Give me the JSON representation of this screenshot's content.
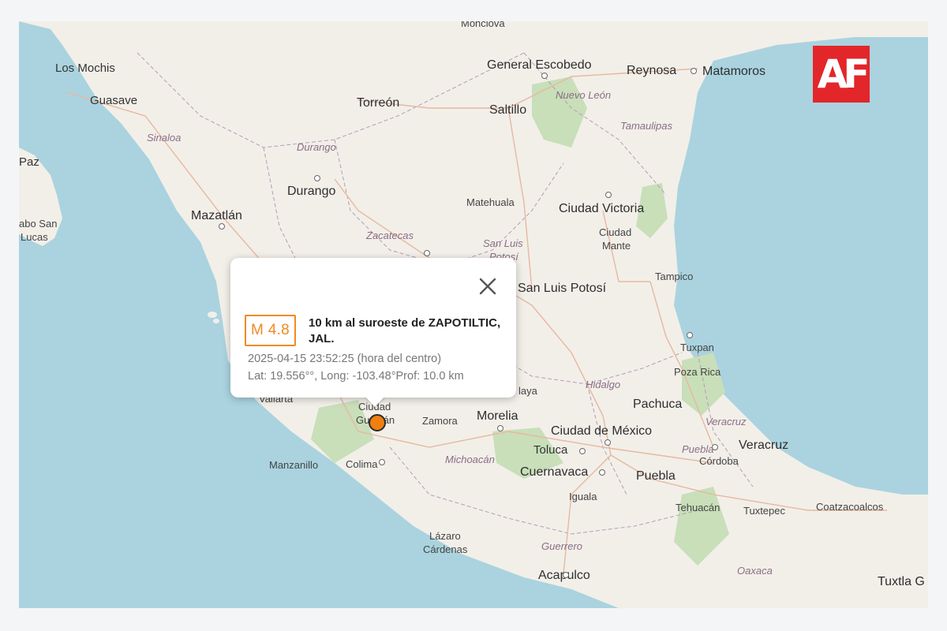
{
  "map": {
    "water_color": "#aad3df",
    "land_color": "#f2efe9",
    "labels": {
      "monclova": "Monclova",
      "los_mochis": "Los Mochis",
      "guasave": "Guasave",
      "torreon": "Torreón",
      "general_escobedo": "General Escobedo",
      "reynosa": "Reynosa",
      "matamoros": "Matamoros",
      "saltillo": "Saltillo",
      "nuevo_leon": "Nuevo León",
      "tamaulipas": "Tamaulipas",
      "sinaloa": "Sinaloa",
      "durango_state": "Durango",
      "paz": "Paz",
      "durango_city": "Durango",
      "matehuala": "Matehuala",
      "ciudad_victoria": "Ciudad Victoria",
      "cabo_san_lucas_1": "abo San",
      "cabo_san_lucas_2": "Lucas",
      "mazatlan": "Mazatlán",
      "ciudad_mante_1": "Ciudad",
      "ciudad_mante_2": "Mante",
      "zacatecas": "Zacatecas",
      "san_luis_state_1": "San Luis",
      "san_luis_state_2": "Potosí",
      "tampico": "Tampico",
      "san_luis_potosi": "San Luis Potosí",
      "tuxpan": "Tuxpan",
      "poza_rica": "Poza Rica",
      "hidalgo": "Hidalgo",
      "celaya_partial": "laya",
      "vallarta": "Vallarta",
      "pachuca": "Pachuca",
      "veracruz_state": "Veracruz",
      "morelia": "Morelia",
      "ciudad_guzman_1": "Ciudad",
      "ciudad_guzman_2": "Guzmán",
      "zamora": "Zamora",
      "ciudad_de_mexico": "Ciudad de México",
      "veracruz_city": "Veracruz",
      "puebla_state": "Puebla",
      "toluca": "Toluca",
      "michoacan": "Michoacán",
      "manzanillo": "Manzanillo",
      "colima": "Colima",
      "cuernavaca": "Cuernavaca",
      "puebla_city": "Puebla",
      "cordoba": "Córdoba",
      "iguala": "Iguala",
      "tehuacan": "Tehuacán",
      "tuxtepec": "Tuxtepec",
      "coatzacoalcos": "Coatzacoalcos",
      "lazaro_1": "Lázaro",
      "lazaro_2": "Cárdenas",
      "guerrero": "Guerrero",
      "oaxaca": "Oaxaca",
      "acapulco": "Acapulco",
      "tuxtla": "Tuxtla G"
    }
  },
  "popup": {
    "magnitude": "M 4.8",
    "location": "10 km al suroeste de ZAPOTILTIC, JAL.",
    "datetime": "2025-04-15   23:52:25 (hora del centro)",
    "coords": "Lat: 19.556°°, Long: -103.48°Prof: 10.0 km",
    "magnitude_color": "#f08a24",
    "close_icon": "close-icon"
  },
  "epicenter": {
    "color": "#f07f11"
  },
  "logo": {
    "text": "AF",
    "color": "#e3262a"
  }
}
